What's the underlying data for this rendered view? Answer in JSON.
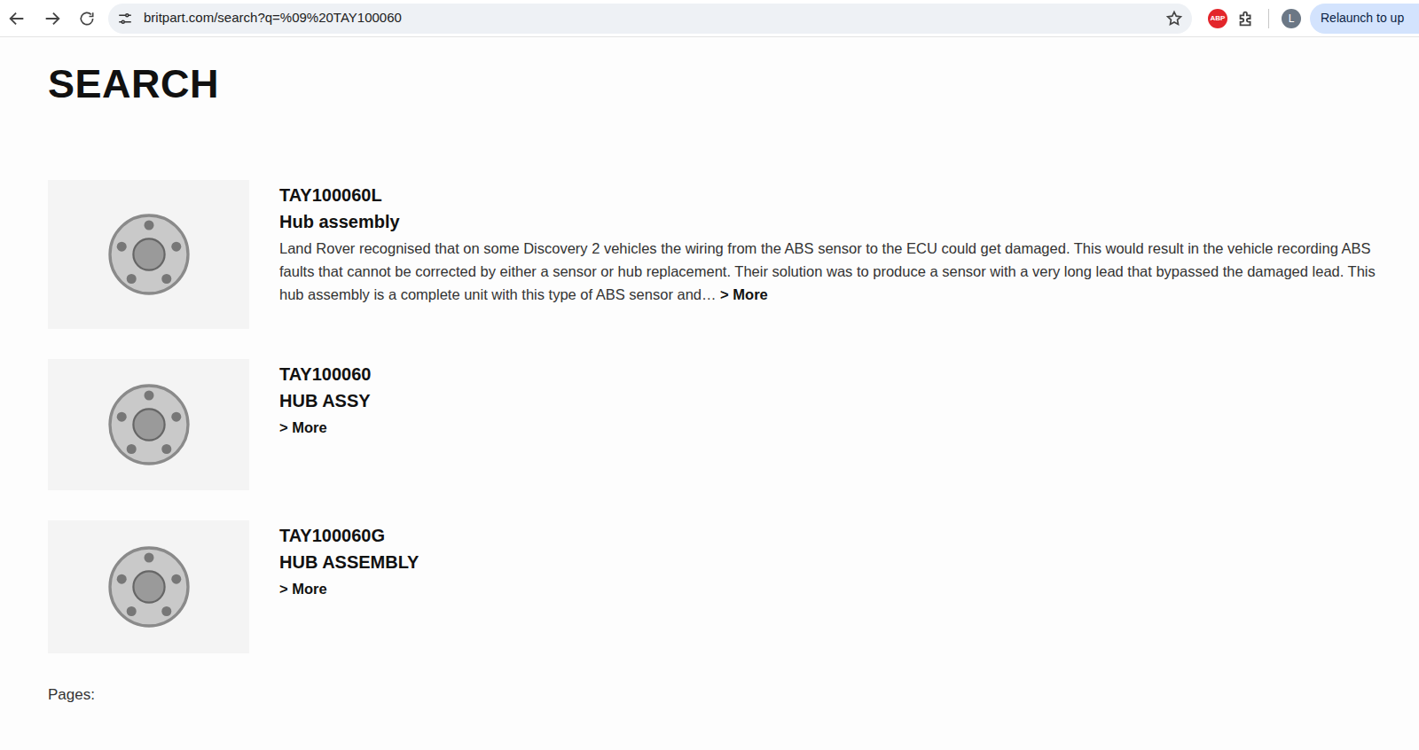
{
  "browser": {
    "url": "britpart.com/search?q=%09%20TAY100060",
    "adblock": "ABP",
    "profile": "L",
    "relaunch": "Relaunch to up"
  },
  "page": {
    "title": "SEARCH",
    "pages_label": "Pages:"
  },
  "results": [
    {
      "code": "TAY100060L",
      "name": "Hub assembly",
      "description": "Land Rover recognised that on some Discovery 2 vehicles the wiring from the ABS sensor to the ECU could get damaged. This would result in the vehicle recording ABS faults that cannot be corrected by either a sensor or hub replacement. Their solution was to produce a sensor with a very long lead that bypassed the damaged lead. This hub assembly is a complete unit with this type of ABS sensor and…",
      "more": "> More"
    },
    {
      "code": "TAY100060",
      "name": "HUB ASSY",
      "description": "",
      "more": "> More"
    },
    {
      "code": "TAY100060G",
      "name": "HUB ASSEMBLY",
      "description": "",
      "more": "> More"
    }
  ]
}
